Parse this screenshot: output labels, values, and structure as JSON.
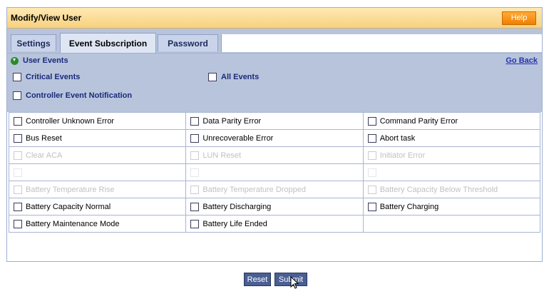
{
  "window": {
    "title": "Modify/View User",
    "help_label": "Help"
  },
  "tabs": [
    {
      "label": "Settings"
    },
    {
      "label": "Event Subscription"
    },
    {
      "label": "Password"
    }
  ],
  "section": {
    "title": "User Events",
    "go_back_label": "Go Back"
  },
  "options": {
    "critical_events": "Critical Events",
    "all_events": "All Events",
    "controller_notification": "Controller Event Notification"
  },
  "events": [
    [
      "Controller Unknown Error",
      "Data Parity Error",
      "Command Parity Error"
    ],
    [
      "Bus Reset",
      "Unrecoverable Error",
      "Abort task"
    ],
    [
      "Clear ACA",
      "LUN Reset",
      "Initiator Error"
    ],
    [
      "",
      "",
      ""
    ],
    [
      "Battery Temperature Rise",
      "Battery Temperature Dropped",
      "Battery Capacity Below Threshold"
    ],
    [
      "Battery Capacity Normal",
      "Battery Discharging",
      "Battery Charging"
    ],
    [
      "Battery Maintenance Mode",
      "Battery Life Ended",
      ""
    ]
  ],
  "buttons": {
    "reset_label": "Reset",
    "submit_label": "Submit"
  },
  "colors": {
    "accent": "#f59a12",
    "header_bg": "#b8c4dc",
    "button_bg": "#4a5f92"
  }
}
